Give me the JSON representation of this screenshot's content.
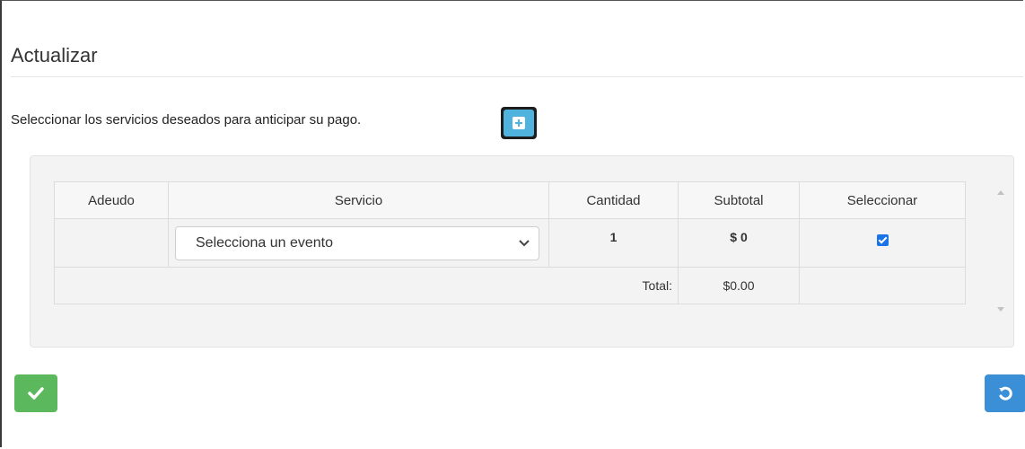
{
  "modal": {
    "title": "Actualizar",
    "instruction": "Seleccionar los servicios deseados para anticipar su pago."
  },
  "table": {
    "headers": [
      "Adeudo",
      "Servicio",
      "Cantidad",
      "Subtotal",
      "Seleccionar"
    ],
    "rows": [
      {
        "adeudo": "",
        "servicio": "Selecciona un evento",
        "cantidad": "1",
        "subtotal": "$ 0",
        "seleccionar": true
      }
    ],
    "total_label": "Total:",
    "total_value": "$0.00"
  },
  "icons": {
    "add": "plus-square-icon",
    "confirm": "check-icon",
    "reset": "undo-icon",
    "dropdown": "chevron-down-icon"
  },
  "colors": {
    "add_button": "#4fb3dd",
    "confirm_button": "#5cb85c",
    "reset_button": "#3b8fd6",
    "checkbox": "#1a73e8"
  }
}
